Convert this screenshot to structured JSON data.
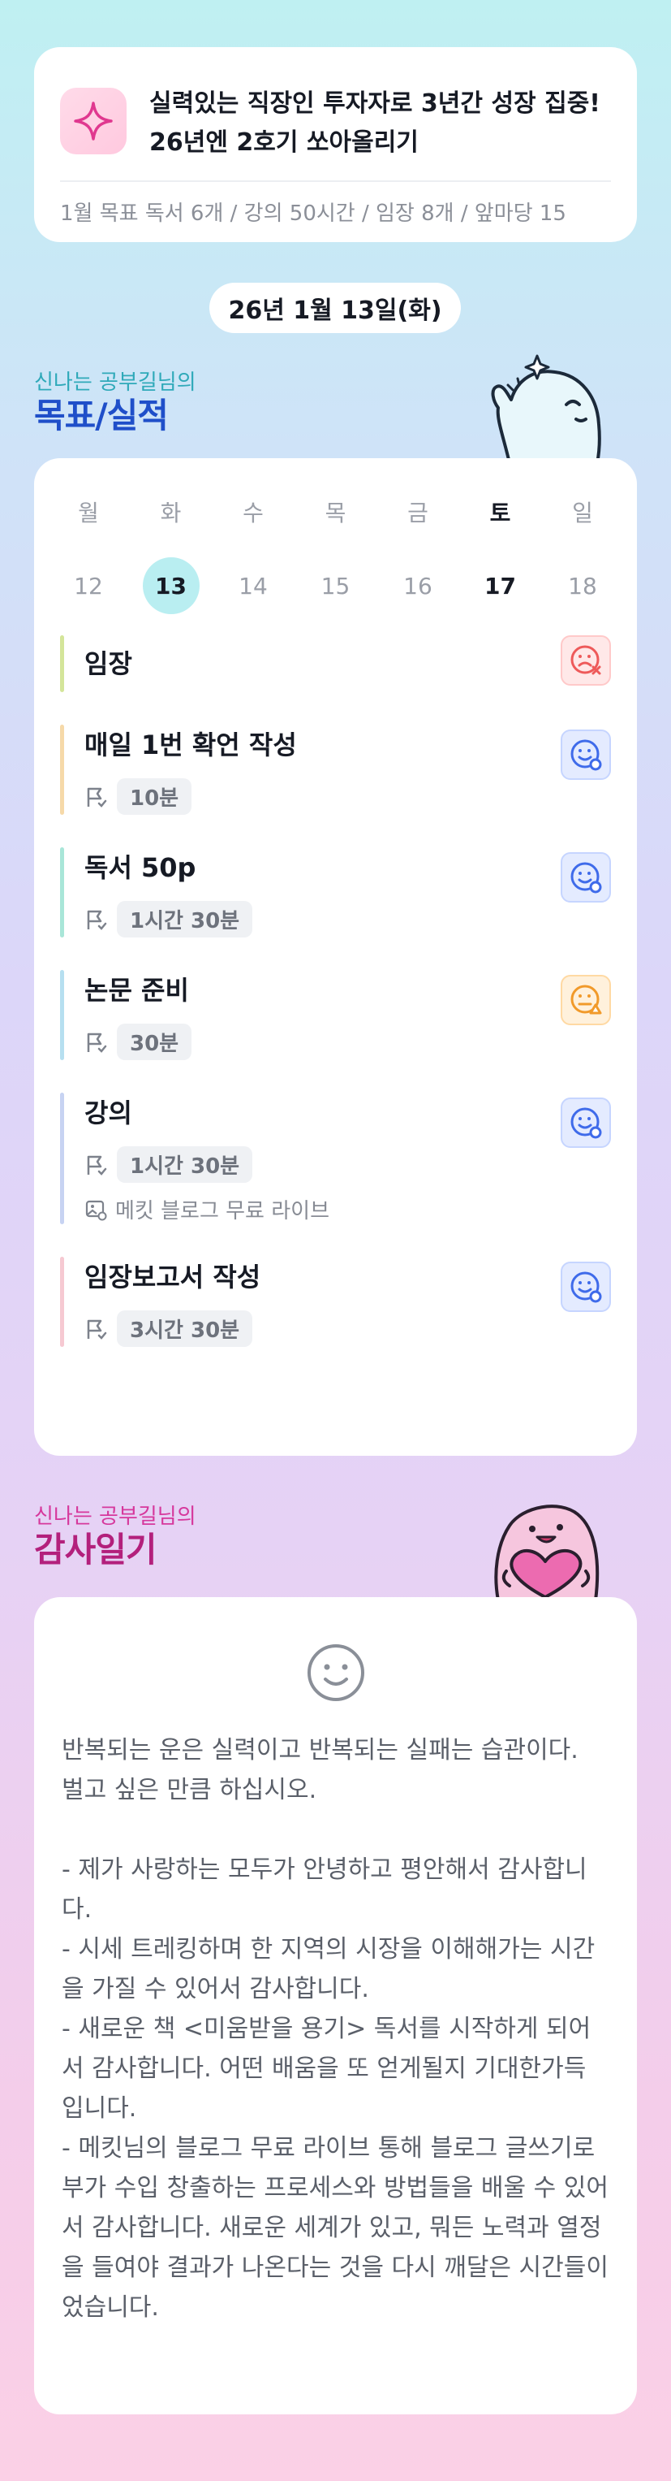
{
  "goal": {
    "icon": "sparkle-icon",
    "title": "실력있는 직장인 투자자로 3년간 성장 집중! 26년엔 2호기 쏘아올리기",
    "subtitle": "1월 목표  독서 6개 / 강의 50시간 / 임장 8개 / 앞마당 15"
  },
  "date_label": "26년 1월 13일(화)",
  "goals_section": {
    "small": "신나는 공부길님의",
    "big": "목표/실적"
  },
  "calendar": {
    "weekdays": [
      "월",
      "화",
      "수",
      "목",
      "금",
      "토",
      "일"
    ],
    "dates": [
      "12",
      "13",
      "14",
      "15",
      "16",
      "17",
      "18"
    ],
    "selected_index": 1
  },
  "tasks": [
    {
      "name": "임장",
      "time": "",
      "note": "",
      "bar_color": "#d4e59a",
      "status": "red",
      "status_icon": "sad-x-icon"
    },
    {
      "name": "매일 1번 확언 작성",
      "time": "10분",
      "note": "",
      "bar_color": "#f6d9a9",
      "status": "blue",
      "status_icon": "smile-check-icon"
    },
    {
      "name": "독서 50p",
      "time": "1시간 30분",
      "note": "",
      "bar_color": "#a9e6d8",
      "status": "blue",
      "status_icon": "smile-check-icon"
    },
    {
      "name": "논문 준비",
      "time": "30분",
      "note": "",
      "bar_color": "#b6dff0",
      "status": "orange",
      "status_icon": "meh-triangle-icon"
    },
    {
      "name": "강의",
      "time": "1시간 30분",
      "note": "메킷 블로그 무료 라이브",
      "bar_color": "#c7d3f2",
      "status": "blue",
      "status_icon": "smile-check-icon"
    },
    {
      "name": "임장보고서 작성",
      "time": "3시간 30분",
      "note": "",
      "bar_color": "#f6c9d2",
      "status": "blue",
      "status_icon": "smile-check-icon"
    }
  ],
  "diary_section": {
    "small": "신나는 공부길님의",
    "big": "감사일기"
  },
  "diary": {
    "text": "반복되는 운은 실력이고 반복되는 실패는 습관이다.\n벌고 싶은 만큼 하십시오.\n\n- 제가 사랑하는 모두가 안녕하고 평안해서 감사합니다.\n- 시세 트레킹하며 한 지역의 시장을 이해해가는 시간을 가질 수 있어서 감사합니다.\n- 새로운 책 <미움받을 용기> 독서를 시작하게 되어서 감사합니다. 어떤 배움을 또 얻게될지 기대한가득 입니다.\n- 메킷님의 블로그 무료 라이브 통해 블로그 글쓰기로 부가 수입 창출하는 프로세스와 방법들을 배울 수 있어서 감사합니다. 새로운 세계가 있고, 뭐든 노력과 열정을 들여야 결과가 나온다는 것을 다시 깨달은 시간들이었습니다."
  },
  "colors": {
    "accent_blue": "#1f4fc9",
    "accent_teal": "#2fa9b9",
    "accent_pink": "#b3207c",
    "selected_date": "#b9eef1"
  }
}
